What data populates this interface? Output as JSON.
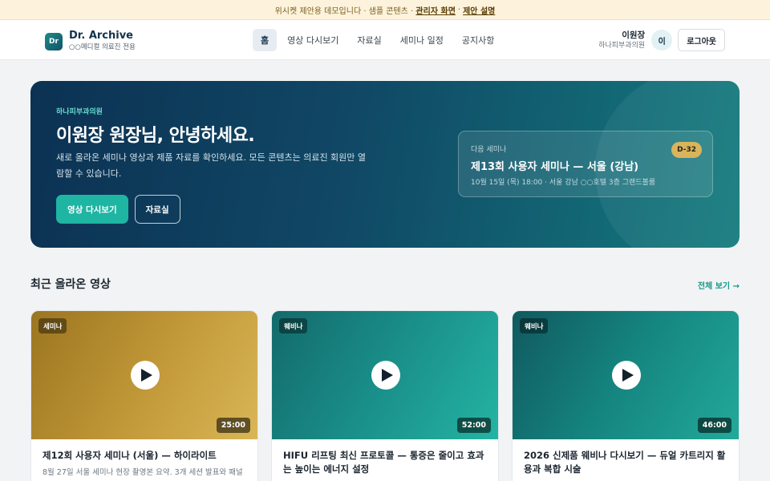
{
  "banner": {
    "text": "위시켓 제안용 데모입니다 · 샘플 콘텐츠 ·",
    "link_admin": "관리자 화면",
    "sep": "·",
    "link_proposal": "제안 설명"
  },
  "header": {
    "logo": "Dr",
    "brand_name": "Dr. Archive",
    "brand_sub": "○○메디컬 의료진 전용",
    "nav": [
      "홈",
      "영상 다시보기",
      "자료실",
      "세미나 일정",
      "공지사항"
    ],
    "user_name": "이원장",
    "user_clinic": "하나피부과의원",
    "avatar": "이",
    "logout": "로그아웃"
  },
  "hero": {
    "clinic": "하나피부과의원",
    "title": "이원장 원장님, 안녕하세요.",
    "desc": "새로 올라온 세미나 영상과 제품 자료를 확인하세요. 모든 콘텐츠는 의료진 회원만 열람할 수 있습니다.",
    "btn_primary": "영상 다시보기",
    "btn_secondary": "자료실",
    "next": {
      "label": "다음 세미나",
      "title": "제13회 사용자 세미나 — 서울 (강남)",
      "info": "10월 15일 (목) 18:00 · 서울 강남 ○○호텔 3층 그랜드볼룸",
      "dday": "D-32"
    }
  },
  "section": {
    "title": "최근 올라온 영상",
    "see_all": "전체 보기 →"
  },
  "videos": [
    {
      "badge": "세미나",
      "duration": "25:00",
      "title": "제12회 사용자 세미나 (서울) — 하이라이트",
      "desc": "8월 27일 서울 세미나 현장 촬영본 요약. 3개 세션 발표와 패널"
    },
    {
      "badge": "웨비나",
      "duration": "52:00",
      "title": "HIFU 리프팅 최신 프로토콜 — 통증은 줄이고 효과는 높이는 에너지 설정",
      "desc": ""
    },
    {
      "badge": "웨비나",
      "duration": "46:00",
      "title": "2026 신제품 웨비나 다시보기 — 듀얼 카트리지 활용과 복합 시술",
      "desc": ""
    }
  ]
}
